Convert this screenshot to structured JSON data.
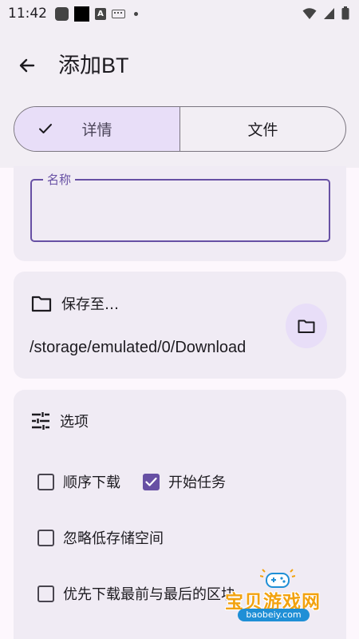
{
  "status_bar": {
    "time": "11:42",
    "icons": [
      "app-icon",
      "black-square-icon",
      "a-icon",
      "keyboard-icon",
      "dot-icon",
      "wifi-icon",
      "cellular-signal-icon",
      "battery-icon"
    ]
  },
  "app_bar": {
    "title": "添加BT",
    "back_icon": "arrow-back-icon"
  },
  "tabs": [
    {
      "label": "详情",
      "selected": true
    },
    {
      "label": "文件",
      "selected": false
    }
  ],
  "name_field": {
    "label": "名称",
    "value": ""
  },
  "save_location": {
    "heading": "保存至…",
    "path": "/storage/emulated/0/Download",
    "button_icon": "folder-icon"
  },
  "options": {
    "heading": "选项",
    "items": [
      {
        "label": "顺序下载",
        "checked": false
      },
      {
        "label": "开始任务",
        "checked": true
      },
      {
        "label": "忽略低存储空间",
        "checked": false
      },
      {
        "label": "优先下载最前与最后的区块",
        "checked": false
      }
    ]
  },
  "watermark": {
    "text": "宝贝游戏网",
    "url": "baobeiy.com"
  },
  "colors": {
    "accent": "#6750a4",
    "tab_selected_bg": "#e8def8",
    "surface": "#f0ebf4",
    "app_bar_bg": "#f2eef4",
    "background": "#fdf7fd",
    "watermark_orange": "#f2a20f",
    "watermark_blue": "#1f8fd6"
  }
}
